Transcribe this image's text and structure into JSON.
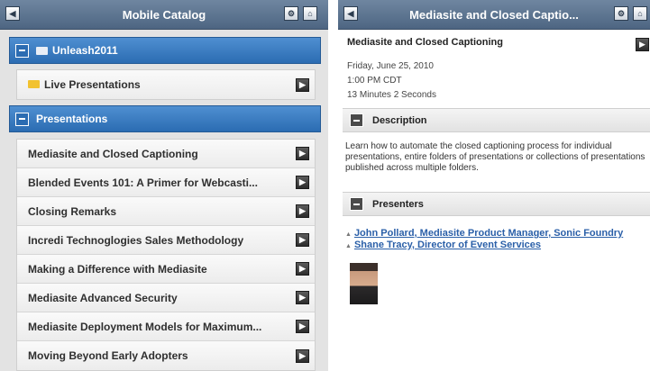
{
  "left": {
    "title": "Mobile Catalog",
    "group1": {
      "label": "Unleash2011",
      "items": [
        "Live Presentations"
      ]
    },
    "group2": {
      "label": "Presentations",
      "items": [
        "Mediasite and Closed Captioning",
        "Blended Events 101: A Primer for Webcasti...",
        "Closing Remarks",
        "Incredi Technoglogies Sales Methodology",
        "Making a Difference with Mediasite",
        "Mediasite Advanced Security",
        "Mediasite Deployment Models for Maximum...",
        "Moving Beyond Early Adopters"
      ]
    }
  },
  "right": {
    "title": "Mediasite and Closed Captio...",
    "heading": "Mediasite and Closed Captioning",
    "date": "Friday, June 25, 2010",
    "time": "1:00 PM CDT",
    "duration": "13 Minutes 2 Seconds",
    "description_label": "Description",
    "description": "Learn how to automate the closed captioning process for individual presentations, entire folders of presentations or collections of presentations published across multiple folders.",
    "presenters_label": "Presenters",
    "presenters": [
      "John Pollard, Mediasite Product Manager, Sonic Foundry",
      "Shane Tracy, Director of Event Services"
    ]
  },
  "icons": {
    "back": "back-icon",
    "settings": "gear-icon",
    "home": "home-icon",
    "chevron": "chevron-right-icon",
    "collapse": "minus-icon",
    "folder": "folder-icon"
  }
}
